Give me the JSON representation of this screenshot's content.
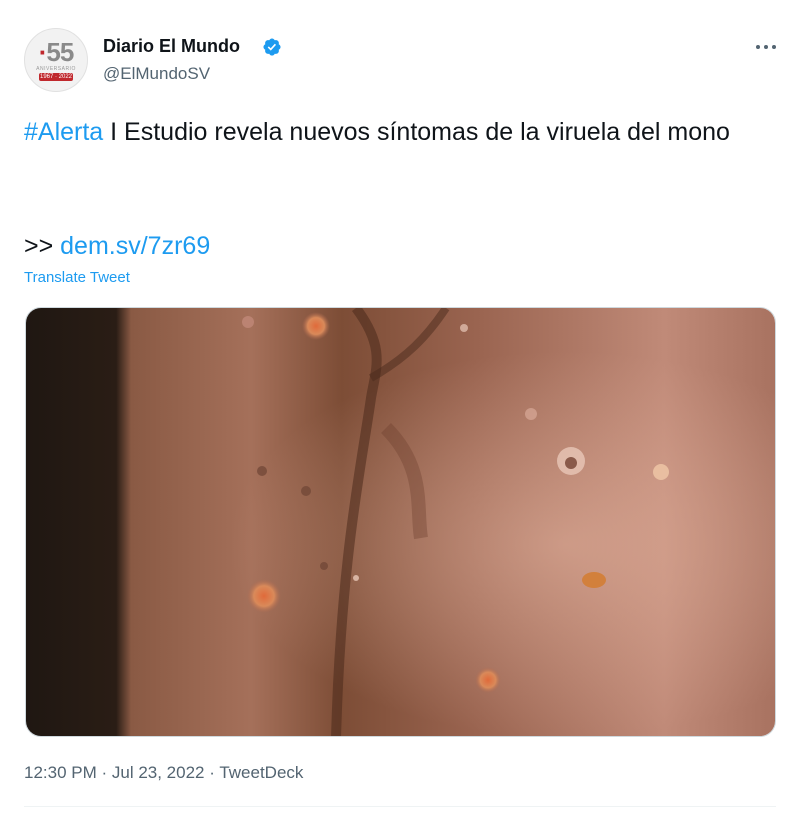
{
  "account": {
    "name": "Diario El Mundo",
    "handle": "@ElMundoSV",
    "avatar_number": "55",
    "avatar_years": "1967 · 2022"
  },
  "tweet": {
    "hashtag": "#Alerta",
    "text": " I Estudio revela nuevos síntomas de la viruela del mono",
    "link_prefix": ">> ",
    "link": "dem.sv/7zr69",
    "translate_label": "Translate Tweet"
  },
  "meta": {
    "time": "12:30 PM",
    "separator_1": " · ",
    "date": "Jul 23, 2022",
    "separator_2": " · ",
    "source": "TweetDeck"
  },
  "icons": {
    "verified": "verified-badge-icon",
    "more": "more-options-icon"
  },
  "colors": {
    "accent": "#1d9bf0",
    "text": "#0f1419",
    "muted": "#536471",
    "brand_red": "#c0282d"
  }
}
